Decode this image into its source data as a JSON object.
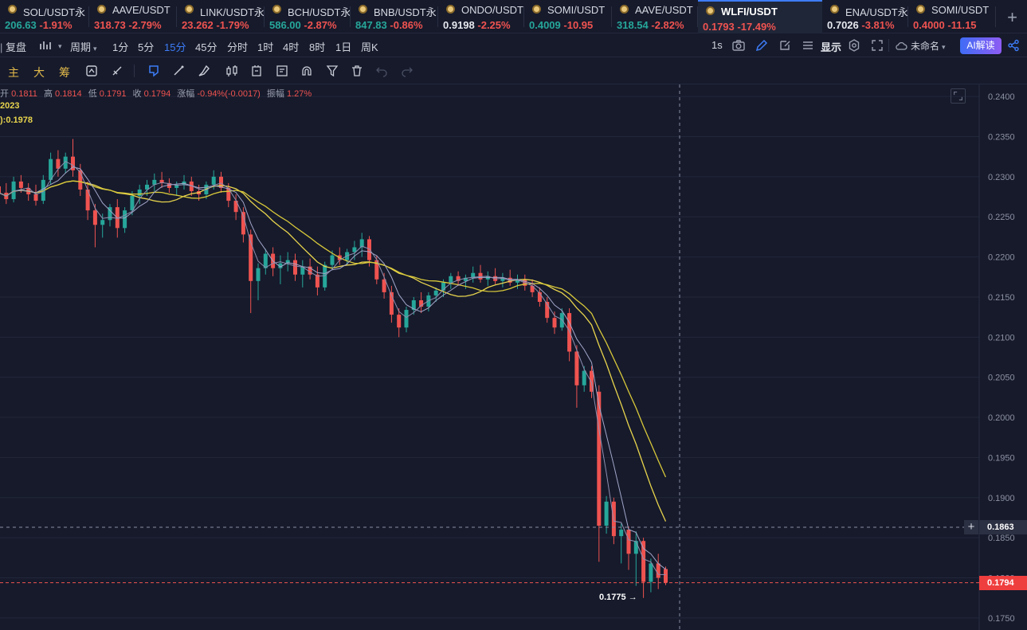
{
  "tabs": [
    {
      "symbol": "SOL/USDT永",
      "price": "206.63",
      "change": "-1.91%",
      "price_color": "up",
      "change_color": "down",
      "active": false
    },
    {
      "symbol": "AAVE/USDT",
      "price": "318.73",
      "change": "-2.79%",
      "price_color": "down",
      "change_color": "down",
      "active": false
    },
    {
      "symbol": "LINK/USDT永",
      "price": "23.262",
      "change": "-1.79%",
      "price_color": "down",
      "change_color": "down",
      "active": false
    },
    {
      "symbol": "BCH/USDT永",
      "price": "586.00",
      "change": "-2.87%",
      "price_color": "up",
      "change_color": "down",
      "active": false
    },
    {
      "symbol": "BNB/USDT永",
      "price": "847.83",
      "change": "-0.86%",
      "price_color": "up",
      "change_color": "down",
      "active": false
    },
    {
      "symbol": "ONDO/USDT",
      "price": "0.9198",
      "change": "-2.25%",
      "price_color": "white",
      "change_color": "down",
      "active": false
    },
    {
      "symbol": "SOMI/USDT",
      "price": "0.4009",
      "change": "-10.95",
      "price_color": "up",
      "change_color": "down",
      "active": false
    },
    {
      "symbol": "AAVE/USDT",
      "price": "318.54",
      "change": "-2.82%",
      "price_color": "up",
      "change_color": "down",
      "active": false
    },
    {
      "symbol": "WLFI/USDT",
      "price": "0.1793",
      "change": "-17.49%",
      "price_color": "down",
      "change_color": "down",
      "active": true
    },
    {
      "symbol": "ENA/USDT永",
      "price": "0.7026",
      "change": "-3.81%",
      "price_color": "white",
      "change_color": "down",
      "active": false
    },
    {
      "symbol": "SOMI/USDT",
      "price": "0.4000",
      "change": "-11.15",
      "price_color": "down",
      "change_color": "down",
      "active": false
    }
  ],
  "add_tab": "+",
  "toolbar1": {
    "replay": "复盘",
    "period": "周期",
    "intervals": [
      "1分",
      "5分",
      "15分",
      "45分",
      "分时",
      "1时",
      "4时",
      "8时",
      "1日",
      "周K"
    ],
    "active_interval": "15分",
    "refresh": "1s",
    "display": "显示",
    "layout_name": "未命名",
    "ai": "AI解读"
  },
  "toolbar2": {
    "indicator_tabs": [
      "主",
      "大",
      "筹"
    ]
  },
  "ohlc": {
    "open_label": "开",
    "open": "0.1811",
    "high_label": "高",
    "high": "0.1814",
    "low_label": "低",
    "low": "0.1791",
    "close_label": "收",
    "close": "0.1794",
    "change_label": "涨幅",
    "change": "-0.94%(-0.0017)",
    "amplitude_label": "振幅",
    "amplitude": "1.27%"
  },
  "ma_text1": "2023",
  "ma_text2": "):0.1978",
  "low_marker": "0.1775 →",
  "crosshair_price": "0.1863",
  "last_price": "0.1794",
  "chart_data": {
    "type": "candlestick",
    "title": "WLFI/USDT 15分",
    "ylim": [
      0.1735,
      0.2415
    ],
    "y_ticks": [
      "0.2400",
      "0.2350",
      "0.2300",
      "0.2250",
      "0.2200",
      "0.2150",
      "0.2100",
      "0.2050",
      "0.2000",
      "0.1950",
      "0.1900",
      "0.1850",
      "0.1800",
      "0.1750"
    ],
    "crosshair_price": 0.1863,
    "last_price": 0.1794,
    "marked_low": 0.1775,
    "colors": {
      "up": "#26a69a",
      "down": "#ef5350",
      "ma_fast": "#a3a6c9",
      "ma_mid": "#8e8fb0",
      "ma_slow1": "#e8d44d",
      "ma_slow2": "#d8c83a",
      "grid": "#22273a",
      "crosshair": "#8a8fa3",
      "last_line": "#ef5350"
    },
    "candles": [
      [
        0.2288,
        0.2296,
        0.227,
        0.228
      ],
      [
        0.228,
        0.2292,
        0.2266,
        0.2272
      ],
      [
        0.2272,
        0.23,
        0.2268,
        0.2294
      ],
      [
        0.2294,
        0.2302,
        0.228,
        0.2286
      ],
      [
        0.2286,
        0.2292,
        0.227,
        0.2278
      ],
      [
        0.2278,
        0.229,
        0.2264,
        0.227
      ],
      [
        0.227,
        0.2302,
        0.2266,
        0.2296
      ],
      [
        0.2296,
        0.233,
        0.229,
        0.2322
      ],
      [
        0.2322,
        0.2333,
        0.23,
        0.231
      ],
      [
        0.231,
        0.233,
        0.2304,
        0.2325
      ],
      [
        0.2325,
        0.2347,
        0.23,
        0.2308
      ],
      [
        0.2308,
        0.2316,
        0.2276,
        0.2284
      ],
      [
        0.2284,
        0.2294,
        0.2246,
        0.2258
      ],
      [
        0.2258,
        0.2266,
        0.2212,
        0.224
      ],
      [
        0.224,
        0.2254,
        0.2224,
        0.2246
      ],
      [
        0.2246,
        0.2266,
        0.2238,
        0.2262
      ],
      [
        0.2262,
        0.2272,
        0.2224,
        0.2236
      ],
      [
        0.2236,
        0.2262,
        0.223,
        0.2258
      ],
      [
        0.2258,
        0.2282,
        0.2252,
        0.2276
      ],
      [
        0.2276,
        0.229,
        0.2266,
        0.2284
      ],
      [
        0.2284,
        0.2296,
        0.2276,
        0.229
      ],
      [
        0.229,
        0.2304,
        0.2282,
        0.2296
      ],
      [
        0.2296,
        0.2306,
        0.2286,
        0.2292
      ],
      [
        0.2292,
        0.2298,
        0.228,
        0.2286
      ],
      [
        0.2286,
        0.2294,
        0.2276,
        0.229
      ],
      [
        0.229,
        0.2302,
        0.2284,
        0.2294
      ],
      [
        0.2294,
        0.23,
        0.2276,
        0.2282
      ],
      [
        0.2282,
        0.229,
        0.227,
        0.2278
      ],
      [
        0.2278,
        0.2294,
        0.2272,
        0.229
      ],
      [
        0.229,
        0.2308,
        0.2284,
        0.23
      ],
      [
        0.23,
        0.2306,
        0.228,
        0.2286
      ],
      [
        0.2286,
        0.2292,
        0.2262,
        0.227
      ],
      [
        0.227,
        0.2278,
        0.2246,
        0.2256
      ],
      [
        0.2256,
        0.2262,
        0.2218,
        0.2228
      ],
      [
        0.2228,
        0.2234,
        0.213,
        0.217
      ],
      [
        0.217,
        0.2192,
        0.2146,
        0.2186
      ],
      [
        0.2186,
        0.221,
        0.2178,
        0.2204
      ],
      [
        0.2204,
        0.2212,
        0.2176,
        0.2186
      ],
      [
        0.2186,
        0.2202,
        0.2166,
        0.2192
      ],
      [
        0.2192,
        0.2206,
        0.2182,
        0.2196
      ],
      [
        0.2196,
        0.2204,
        0.217,
        0.2178
      ],
      [
        0.2178,
        0.2196,
        0.2162,
        0.2188
      ],
      [
        0.2188,
        0.2198,
        0.2172,
        0.2178
      ],
      [
        0.2178,
        0.2188,
        0.2152,
        0.2162
      ],
      [
        0.2162,
        0.2194,
        0.2158,
        0.219
      ],
      [
        0.219,
        0.2208,
        0.2184,
        0.2202
      ],
      [
        0.2202,
        0.2212,
        0.219,
        0.2196
      ],
      [
        0.2196,
        0.221,
        0.219,
        0.2206
      ],
      [
        0.2206,
        0.222,
        0.2196,
        0.2212
      ],
      [
        0.2212,
        0.223,
        0.22,
        0.2222
      ],
      [
        0.2222,
        0.2226,
        0.2188,
        0.2196
      ],
      [
        0.2196,
        0.2202,
        0.2166,
        0.2172
      ],
      [
        0.2172,
        0.218,
        0.2148,
        0.2156
      ],
      [
        0.2156,
        0.2164,
        0.2118,
        0.2128
      ],
      [
        0.2128,
        0.2136,
        0.21,
        0.2112
      ],
      [
        0.2112,
        0.2138,
        0.2106,
        0.2134
      ],
      [
        0.2134,
        0.215,
        0.2128,
        0.2146
      ],
      [
        0.2146,
        0.2156,
        0.213,
        0.2138
      ],
      [
        0.2138,
        0.2156,
        0.2132,
        0.2152
      ],
      [
        0.2152,
        0.2162,
        0.2144,
        0.2158
      ],
      [
        0.2158,
        0.2172,
        0.215,
        0.2168
      ],
      [
        0.2168,
        0.218,
        0.216,
        0.2176
      ],
      [
        0.2176,
        0.2182,
        0.2164,
        0.217
      ],
      [
        0.217,
        0.2178,
        0.216,
        0.2174
      ],
      [
        0.2174,
        0.2188,
        0.2168,
        0.218
      ],
      [
        0.218,
        0.219,
        0.2168,
        0.2172
      ],
      [
        0.2172,
        0.2182,
        0.2164,
        0.2176
      ],
      [
        0.2176,
        0.2186,
        0.2166,
        0.217
      ],
      [
        0.217,
        0.218,
        0.2162,
        0.2174
      ],
      [
        0.2174,
        0.2184,
        0.2164,
        0.2168
      ],
      [
        0.2168,
        0.2178,
        0.216,
        0.2172
      ],
      [
        0.2172,
        0.2178,
        0.2158,
        0.2164
      ],
      [
        0.2164,
        0.2172,
        0.215,
        0.2156
      ],
      [
        0.2156,
        0.2162,
        0.2138,
        0.2144
      ],
      [
        0.2144,
        0.215,
        0.2118,
        0.2124
      ],
      [
        0.2124,
        0.2132,
        0.2104,
        0.2112
      ],
      [
        0.2112,
        0.2136,
        0.2108,
        0.213
      ],
      [
        0.213,
        0.2136,
        0.207,
        0.2082
      ],
      [
        0.2082,
        0.209,
        0.2012,
        0.204
      ],
      [
        0.204,
        0.2064,
        0.2032,
        0.2058
      ],
      [
        0.2058,
        0.2064,
        0.2024,
        0.2032
      ],
      [
        0.2032,
        0.204,
        0.182,
        0.1865
      ],
      [
        0.1865,
        0.1902,
        0.1855,
        0.1895
      ],
      [
        0.1895,
        0.19,
        0.1842,
        0.1852
      ],
      [
        0.1852,
        0.1868,
        0.1818,
        0.186
      ],
      [
        0.186,
        0.1864,
        0.181,
        0.183
      ],
      [
        0.183,
        0.1858,
        0.179,
        0.1846
      ],
      [
        0.1846,
        0.185,
        0.1775,
        0.1795
      ],
      [
        0.1795,
        0.1824,
        0.1782,
        0.1818
      ],
      [
        0.1818,
        0.183,
        0.1786,
        0.18
      ],
      [
        0.1811,
        0.1814,
        0.1791,
        0.1794
      ]
    ]
  }
}
